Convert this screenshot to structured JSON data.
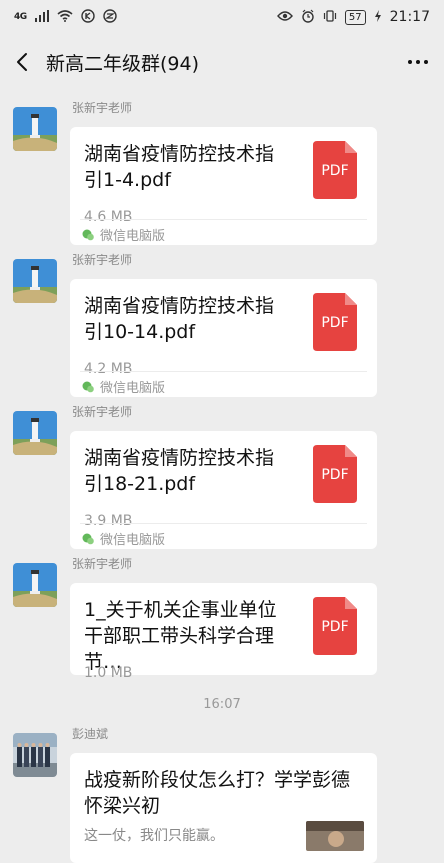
{
  "status_bar": {
    "network": "4G",
    "battery": "57",
    "time": "21:17"
  },
  "header": {
    "title": "新高二年级群(94)"
  },
  "messages": [
    {
      "sender": "张新宇老师",
      "file_name": "湖南省疫情防控技术指引1-4.pdf",
      "file_size": "4.6 MB",
      "source": "微信电脑版",
      "icon_label": "PDF"
    },
    {
      "sender": "张新宇老师",
      "file_name": "湖南省疫情防控技术指引10-14.pdf",
      "file_size": "4.2 MB",
      "source": "微信电脑版",
      "icon_label": "PDF"
    },
    {
      "sender": "张新宇老师",
      "file_name": "湖南省疫情防控技术指引18-21.pdf",
      "file_size": "3.9 MB",
      "source": "微信电脑版",
      "icon_label": "PDF"
    },
    {
      "sender": "张新宇老师",
      "file_name": "1_关于机关企事业单位干部职工带头科学合理节…",
      "file_size": "1.0 MB",
      "icon_label": "PDF"
    }
  ],
  "time_separator": "16:07",
  "article": {
    "sender": "彭迪斌",
    "title": "战疫新阶段仗怎么打？学学彭德怀梁兴初",
    "description": "这一仗，我们只能赢。"
  },
  "colors": {
    "background": "#ededed",
    "pdf_red": "#e64340",
    "bubble": "#ffffff"
  }
}
